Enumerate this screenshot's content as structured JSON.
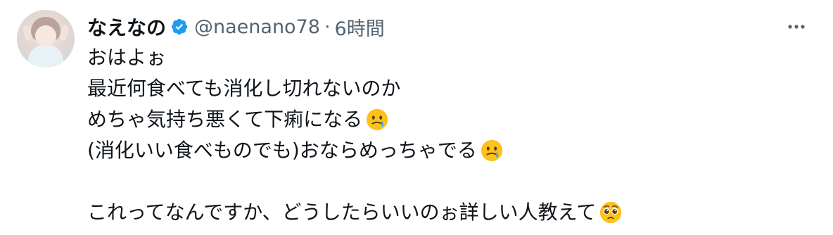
{
  "author": {
    "display_name": "なえなの",
    "handle": "@naenano78",
    "separator": "·",
    "timestamp": "6時間",
    "verified": true,
    "avatar_icon": "profile-photo"
  },
  "tweet": {
    "lines": [
      {
        "text": "おはよぉ",
        "emoji": ""
      },
      {
        "text": "最近何食べても消化し切れないのか",
        "emoji": ""
      },
      {
        "text": "めちゃ気持ち悪くて下痢になる",
        "emoji": "face-holding-back-tears-icon"
      },
      {
        "text": "(消化いい食べものでも)おならめっちゃでる",
        "emoji": "face-holding-back-tears-icon"
      },
      {
        "text": "",
        "emoji": ""
      },
      {
        "text": "これってなんですか、どうしたらいいのぉ詳しい人教えて",
        "emoji": "pleading-face-icon"
      }
    ]
  },
  "colors": {
    "text_primary": "#0f1419",
    "text_secondary": "#536471",
    "verified_blue": "#1d9bf0",
    "background": "#ffffff"
  },
  "icons": {
    "more": "more-horizontal-icon",
    "verified": "verified-badge-icon"
  }
}
